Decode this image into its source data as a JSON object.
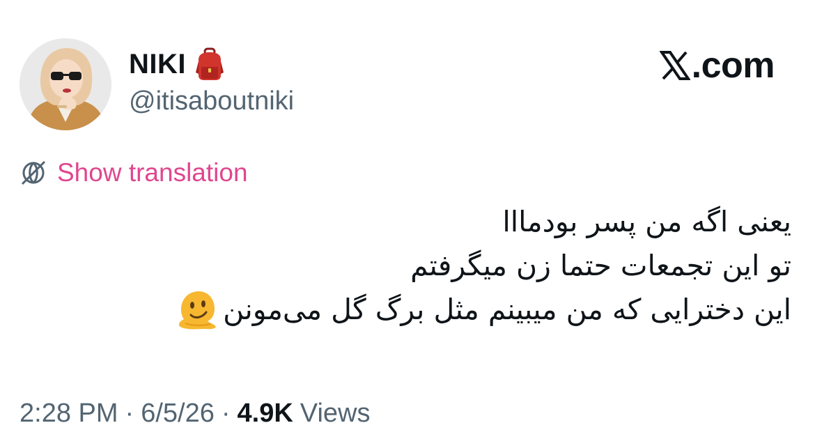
{
  "author": {
    "display_name": "NIKI",
    "handle": "@itisaboutniki",
    "name_emoji": "backpack-icon",
    "avatar": "avatar-illustration"
  },
  "brand": {
    "label": ".com",
    "logo": "x-logo-icon"
  },
  "translation": {
    "label": "Show translation",
    "icon": "globe-icon",
    "color": "#e0468f"
  },
  "tweet": {
    "lines": [
      "یعنی اگه من پسر بودمااا",
      "تو این تجمعات حتما زن میگرفتم",
      "این دخترایی که من میبینم مثل برگ گل می‌مونن"
    ],
    "trailing_emoji": "melting-face-icon"
  },
  "meta": {
    "time": "2:28 PM",
    "separator": "·",
    "date": "6/5/26",
    "views_count": "4.9K",
    "views_label": "Views"
  },
  "colors": {
    "text_primary": "#0f1419",
    "text_secondary": "#536471",
    "accent": "#e0468f"
  }
}
